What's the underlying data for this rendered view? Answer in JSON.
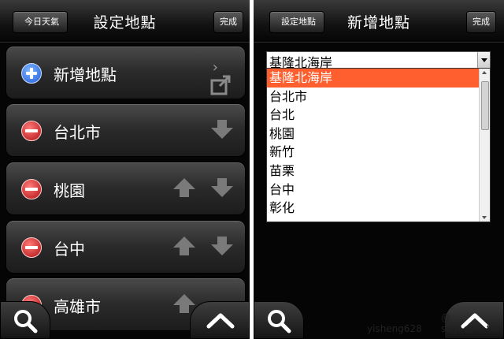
{
  "left": {
    "back_label": "今日天氣",
    "title": "設定地點",
    "done_label": "完成",
    "rows": [
      {
        "label": "新增地點",
        "kind": "add"
      },
      {
        "label": "台北市",
        "kind": "remove"
      },
      {
        "label": "桃園",
        "kind": "remove"
      },
      {
        "label": "台中",
        "kind": "remove"
      },
      {
        "label": "高雄市",
        "kind": "remove"
      }
    ]
  },
  "right": {
    "back_label": "設定地點",
    "title": "新增地點",
    "done_label": "完成",
    "select_value": "基隆北海岸",
    "options": [
      "基隆北海岸",
      "台北市",
      "台北",
      "桃園",
      "新竹",
      "苗栗",
      "台中",
      "彰化"
    ],
    "selected_index": 0
  },
  "watermark": {
    "user": "yisheng628",
    "site": "@ sogi.com.tw"
  },
  "colors": {
    "accent_selected": "#ff5f2e",
    "add_icon": "#1f5ed8",
    "remove_icon": "#b01010"
  },
  "icons": [
    "back-arrow-icon",
    "plus-icon",
    "minus-icon",
    "up-arrow-icon",
    "down-arrow-icon",
    "chevron-right-icon",
    "open-external-icon",
    "search-icon",
    "chevron-up-icon"
  ]
}
